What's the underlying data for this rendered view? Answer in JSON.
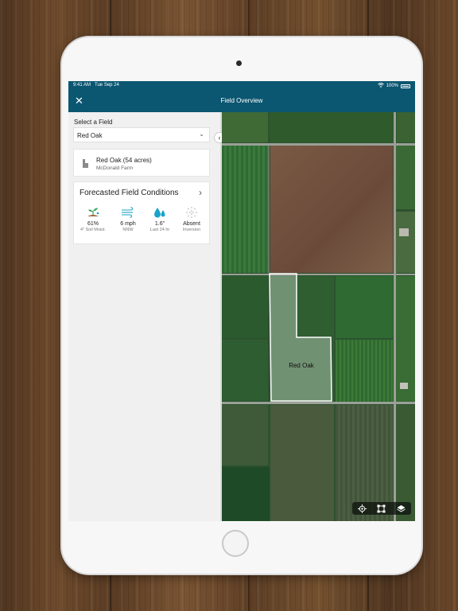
{
  "status_bar": {
    "time": "9:41 AM",
    "date": "Tue Sep 24",
    "battery": "100%",
    "wifi_icon": "wifi-icon",
    "battery_icon": "battery-icon"
  },
  "nav": {
    "title": "Field Overview",
    "close_icon": "close-icon"
  },
  "field_selector": {
    "label": "Select a Field",
    "value": "Red Oak",
    "chevron_icon": "chevron-down-icon"
  },
  "field_card": {
    "name": "Red Oak (54 acres)",
    "farm": "McDonald Farm",
    "icon": "field-shape-icon"
  },
  "conditions": {
    "title": "Forecasted Field Conditions",
    "metrics": [
      {
        "value": "61%",
        "sub": "4\" Soil Moist.",
        "icon": "soil-moisture-icon"
      },
      {
        "value": "6 mph",
        "sub": "NNW",
        "icon": "wind-icon"
      },
      {
        "value": "1.6\"",
        "sub": "Last 24 hr",
        "icon": "rain-drops-icon"
      },
      {
        "value": "Absent",
        "sub": "Inversion",
        "icon": "inversion-icon"
      }
    ]
  },
  "map": {
    "field_label": "Red Oak",
    "tools": [
      "locate-icon",
      "fit-bounds-icon",
      "layers-icon"
    ]
  },
  "colors": {
    "header": "#0b5671",
    "accent": "#1aa3c8",
    "panel": "#f0f0f0"
  }
}
